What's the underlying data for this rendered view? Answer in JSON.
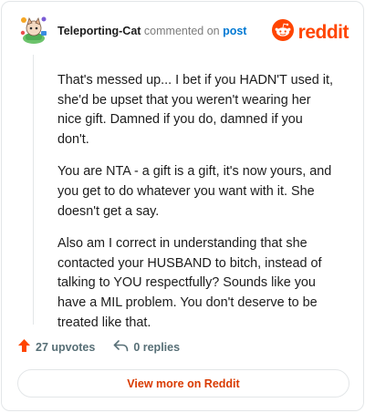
{
  "comment": {
    "username": "Teleporting-Cat",
    "action_text": " commented on ",
    "post_link_label": "post",
    "paragraphs": [
      "That's messed up... I bet if you HADN'T used it, she'd be upset that you weren't wearing her nice gift. Damned if you do, damned if you don't.",
      "You are NTA - a gift is a gift, it's now yours, and you get to do whatever you want with it. She doesn't get a say.",
      "Also am I correct in understanding that she contacted your HUSBAND to bitch, instead of talking to YOU respectfully? Sounds like you have a MIL problem. You don't deserve to be treated like that."
    ]
  },
  "brand": {
    "wordmark": "reddit",
    "color": "#ff4500"
  },
  "actions": {
    "upvotes_label": "27 upvotes",
    "replies_label": "0 replies"
  },
  "footer": {
    "view_more_label": "View more on Reddit"
  },
  "icons": {
    "avatar": "cat-avatar-icon",
    "brand": "reddit-snoo-icon",
    "upvote": "upvote-arrow-icon",
    "reply": "reply-arrow-icon"
  },
  "colors": {
    "link": "#0079d3",
    "upvote": "#ff4500",
    "view_more": "#d93a00",
    "muted": "#576f76"
  }
}
